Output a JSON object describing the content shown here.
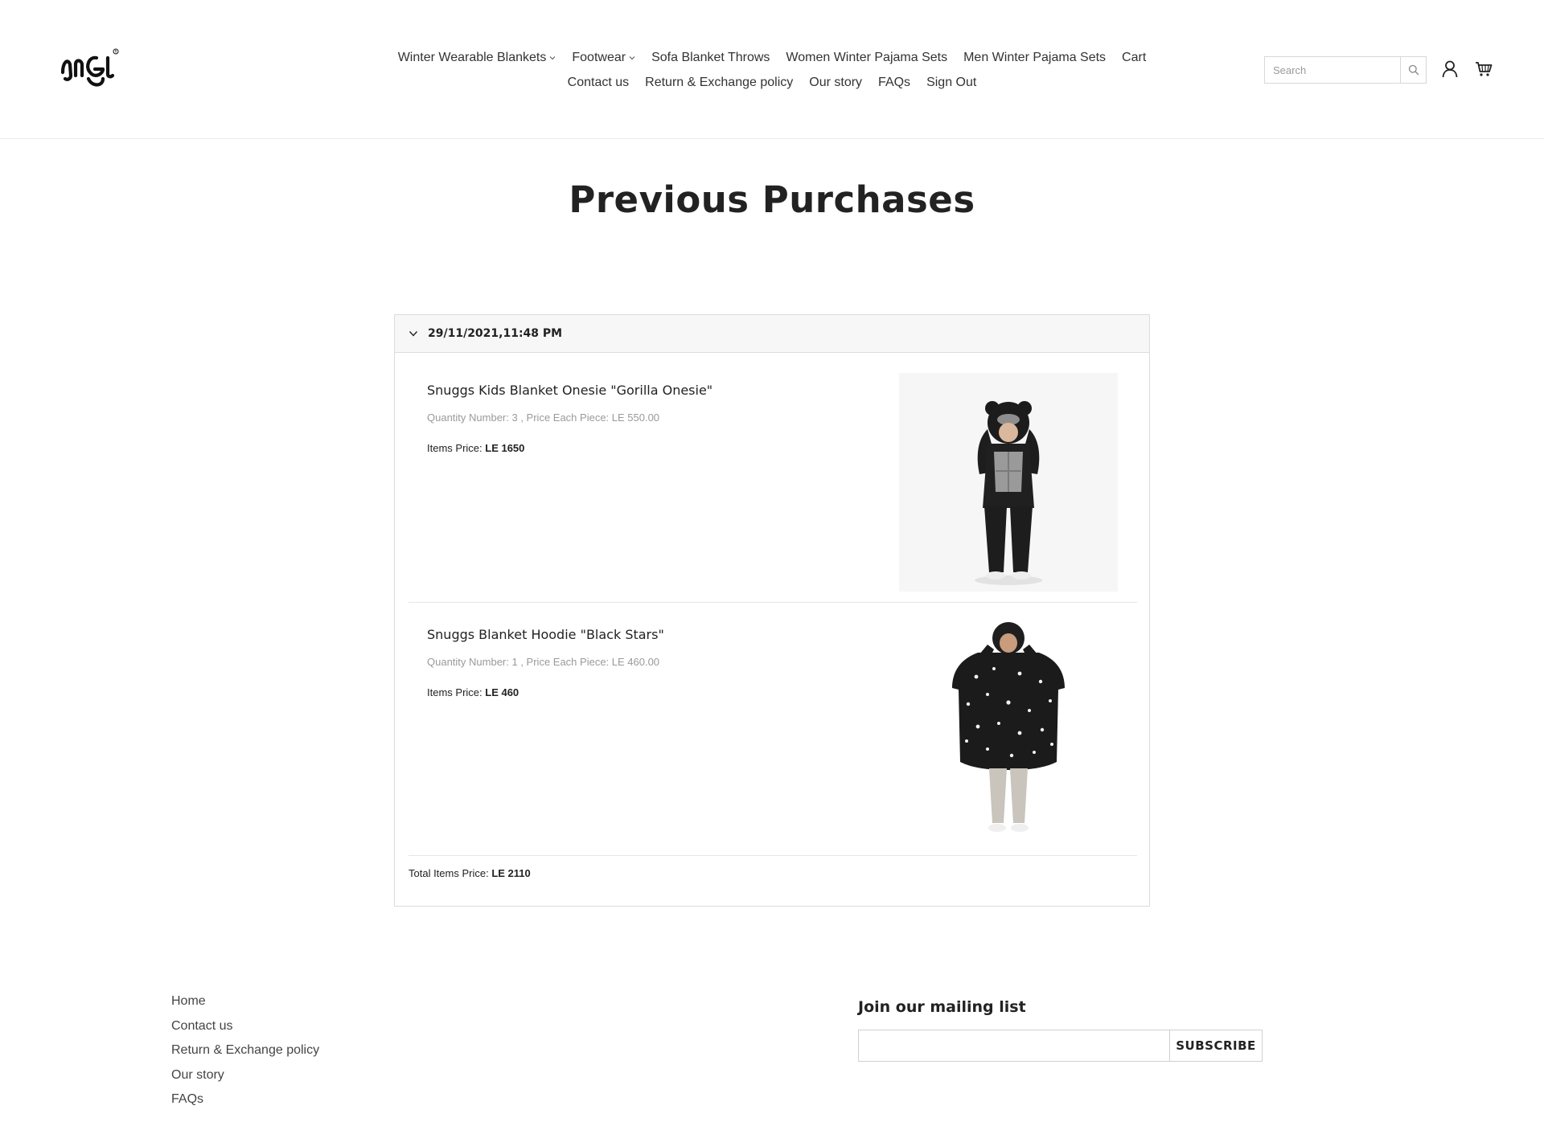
{
  "header": {
    "logo_icon": "snuggs-logo",
    "nav_row1": [
      {
        "label": "Winter Wearable Blankets",
        "dropdown": true
      },
      {
        "label": "Footwear",
        "dropdown": true
      },
      {
        "label": "Sofa Blanket Throws",
        "dropdown": false
      },
      {
        "label": "Women Winter Pajama Sets",
        "dropdown": false
      },
      {
        "label": "Men Winter Pajama Sets",
        "dropdown": false
      },
      {
        "label": "Cart",
        "dropdown": false
      }
    ],
    "nav_row2": [
      {
        "label": "Contact us"
      },
      {
        "label": "Return & Exchange policy"
      },
      {
        "label": "Our story"
      },
      {
        "label": "FAQs"
      },
      {
        "label": "Sign Out"
      }
    ],
    "search": {
      "placeholder": "Search",
      "icon": "search-icon"
    },
    "account_icon": "user-icon",
    "cart_icon": "cart-icon"
  },
  "page": {
    "title": "Previous Purchases"
  },
  "order": {
    "date": "29/11/2021,11:48 PM",
    "toggle_icon": "chevron-down-icon",
    "items": [
      {
        "name": "Snuggs Kids Blanket Onesie \"Gorilla Onesie\"",
        "qty_line": "Quantity Number: 3 , Price Each Piece: LE 550.00",
        "price_label": "Items Price: ",
        "price_value": "LE 1650"
      },
      {
        "name": "Snuggs Blanket Hoodie \"Black Stars\"",
        "qty_line": "Quantity Number: 1 , Price Each Piece: LE 460.00",
        "price_label": "Items Price: ",
        "price_value": "LE 460"
      }
    ],
    "total_label": "Total Items Price: ",
    "total_value": "LE 2110"
  },
  "footer": {
    "links": [
      "Home",
      "Contact us",
      "Return & Exchange policy",
      "Our story",
      "FAQs"
    ],
    "mailing_title": "Join our mailing list",
    "email_value": "",
    "subscribe_label": "SUBSCRIBE"
  }
}
